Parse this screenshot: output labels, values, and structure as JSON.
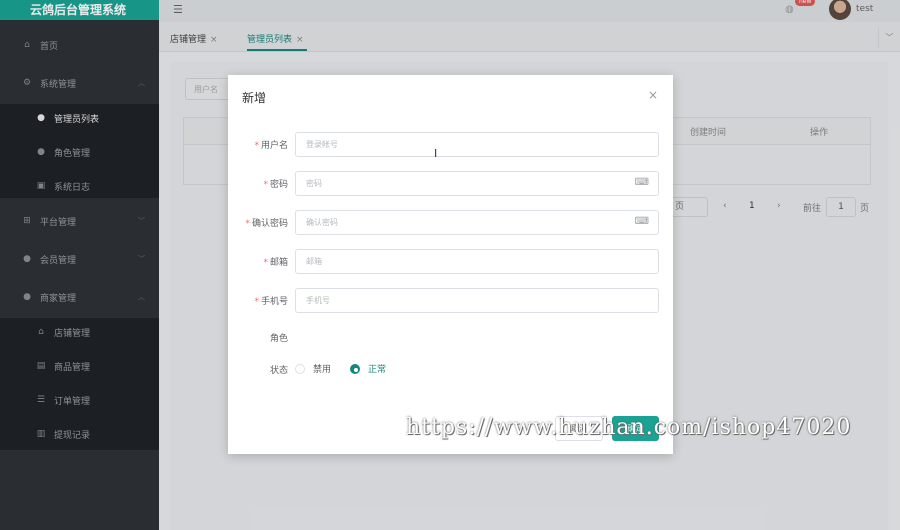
{
  "app": {
    "title": "云鸽后台管理系统"
  },
  "colors": {
    "accent": "#1aa394",
    "sidebar": "#2e3136",
    "badge": "#e05a5a"
  },
  "sidebar": {
    "items": [
      {
        "label": "首页",
        "icon": "home-icon"
      },
      {
        "label": "系统管理",
        "icon": "gear-icon"
      },
      {
        "label": "管理员列表",
        "icon": "user-icon"
      },
      {
        "label": "角色管理",
        "icon": "user-icon"
      },
      {
        "label": "系统日志",
        "icon": "log-icon"
      },
      {
        "label": "平台管理",
        "icon": "grid-icon"
      },
      {
        "label": "会员管理",
        "icon": "user-icon"
      },
      {
        "label": "商家管理",
        "icon": "user-icon"
      },
      {
        "label": "店铺管理",
        "icon": "home-icon"
      },
      {
        "label": "商品管理",
        "icon": "list-icon"
      },
      {
        "label": "订单管理",
        "icon": "list-icon"
      },
      {
        "label": "提现记录",
        "icon": "chart-icon"
      }
    ]
  },
  "header": {
    "badge": "new",
    "username": "test"
  },
  "tabs": [
    {
      "label": "店铺管理"
    },
    {
      "label": "管理员列表"
    }
  ],
  "main": {
    "search_placeholder": "用户名",
    "table_headers": [
      "创建时间",
      "操作"
    ],
    "pager": {
      "page_suffix": "页",
      "current": "1",
      "goto_label": "前往",
      "goto_value": "1",
      "goto_suffix": "页"
    }
  },
  "modal": {
    "title": "新增",
    "fields": [
      {
        "label": "用户名",
        "required": true,
        "placeholder": "登录帐号"
      },
      {
        "label": "密码",
        "required": true,
        "placeholder": "密码"
      },
      {
        "label": "确认密码",
        "required": true,
        "placeholder": "确认密码"
      },
      {
        "label": "邮箱",
        "required": true,
        "placeholder": "邮箱"
      },
      {
        "label": "手机号",
        "required": true,
        "placeholder": "手机号"
      }
    ],
    "role_label": "角色",
    "status_label": "状态",
    "status_options": [
      {
        "label": "禁用",
        "checked": false
      },
      {
        "label": "正常",
        "checked": true
      }
    ],
    "cancel_label": "取消",
    "ok_label": "确定"
  },
  "watermark": "https://www.huzhan.com/ishop47020"
}
